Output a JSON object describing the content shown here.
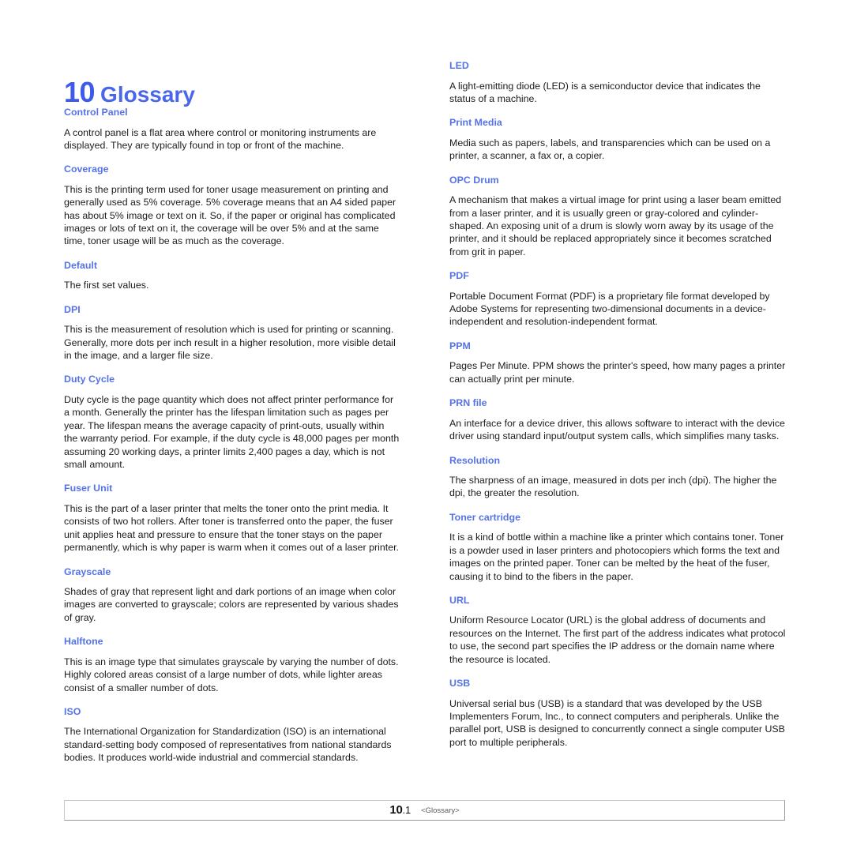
{
  "document": {
    "chapter_number": "10",
    "chapter_name": "Glossary",
    "accent_title_color": "#3d5ae8",
    "accent_term_color": "#5572e8",
    "body_text_color": "#1c1c1c",
    "page_background": "#ffffff"
  },
  "footer": {
    "page_major": "10",
    "page_minor": ".1",
    "section_label": "<Glossary>"
  },
  "columns": {
    "left": [
      {
        "term": "Control Panel",
        "definition": "A control panel is a flat area where control or monitoring instruments are displayed. They are typically found in top or front of the machine."
      },
      {
        "term": "Coverage",
        "definition": "This is the printing term used for toner usage measurement on printing and generally used as 5% coverage. 5% coverage means that an A4 sided paper has about 5% image or text on it. So, if the paper or original has complicated images or lots of text on it, the coverage will be over 5% and at the same time, toner usage will be as much as the coverage."
      },
      {
        "term": "Default",
        "definition": "The first set values."
      },
      {
        "term": "DPI",
        "definition": "This is the measurement of resolution which is used for printing or scanning. Generally, more dots per inch result in a higher resolution, more visible detail in the image, and a larger file size."
      },
      {
        "term": "Duty Cycle",
        "definition": "Duty cycle is the page quantity which does not affect printer performance for a month. Generally the printer has the lifespan limitation such as pages per year. The lifespan means the average capacity of print-outs, usually within the warranty period. For example, if the duty cycle is 48,000 pages per month assuming 20 working days, a printer limits 2,400 pages a day, which is not small amount."
      },
      {
        "term": "Fuser Unit",
        "definition": "This is the part of a laser printer that melts the toner onto the print media. It consists of two hot rollers. After toner is transferred onto the paper, the fuser unit applies heat and pressure to ensure that the toner stays on the paper permanently, which is why paper is warm when it comes out of a laser printer."
      },
      {
        "term": "Grayscale",
        "definition": "Shades of gray that represent light and dark portions of an image when color images are converted to grayscale; colors are represented by various shades of gray."
      },
      {
        "term": "Halftone",
        "definition": "This is an image type that simulates grayscale by varying the number of dots. Highly colored areas consist of a large number of dots, while lighter areas consist of a smaller number of dots."
      },
      {
        "term": "ISO",
        "definition": "The International Organization for Standardization (ISO) is an international standard-setting body composed of representatives from national standards bodies. It produces world-wide industrial and commercial standards."
      }
    ],
    "right": [
      {
        "term": "LED",
        "definition": "A light-emitting diode (LED) is a semiconductor device that indicates the status of a machine."
      },
      {
        "term": "Print Media",
        "definition": "Media such as papers, labels, and transparencies which can be used on a printer, a scanner, a fax or, a copier."
      },
      {
        "term": "OPC Drum",
        "definition": "A mechanism that makes a virtual image for print using a laser beam emitted from a laser printer, and it is usually green or gray-colored and cylinder-shaped. An exposing unit of a drum is slowly worn away by its usage of the printer, and it should be replaced appropriately since it becomes scratched from grit in paper."
      },
      {
        "term": "PDF",
        "definition": "Portable Document Format (PDF) is a proprietary file format developed by Adobe Systems for representing two-dimensional documents in a device-independent and resolution-independent format."
      },
      {
        "term": "PPM",
        "definition": "Pages Per Minute. PPM shows the printer's speed, how many pages a printer can actually print per minute."
      },
      {
        "term": "PRN file",
        "definition": "An interface for a device driver, this allows software to interact with the device driver using standard input/output system calls, which simplifies many tasks."
      },
      {
        "term": "Resolution",
        "definition": "The sharpness of an image, measured in dots per inch (dpi). The higher the dpi, the greater the resolution."
      },
      {
        "term": "Toner cartridge",
        "definition": "It is a kind of bottle within a machine like a printer which contains toner. Toner is a powder used in laser printers and photocopiers which forms the text and images on the printed paper. Toner can be melted by the heat of the fuser, causing it to bind to the fibers in the paper."
      },
      {
        "term": "URL",
        "definition": "Uniform Resource Locator (URL) is the global address of documents and resources on the Internet. The first part of the address indicates what protocol to use, the second part specifies the IP address or the domain name where the resource is located."
      },
      {
        "term": "USB",
        "definition": "Universal serial bus (USB) is a standard that was developed by the USB Implementers Forum, Inc., to connect computers and peripherals. Unlike the parallel port, USB is designed to concurrently connect a single computer USB port to multiple peripherals."
      }
    ]
  }
}
